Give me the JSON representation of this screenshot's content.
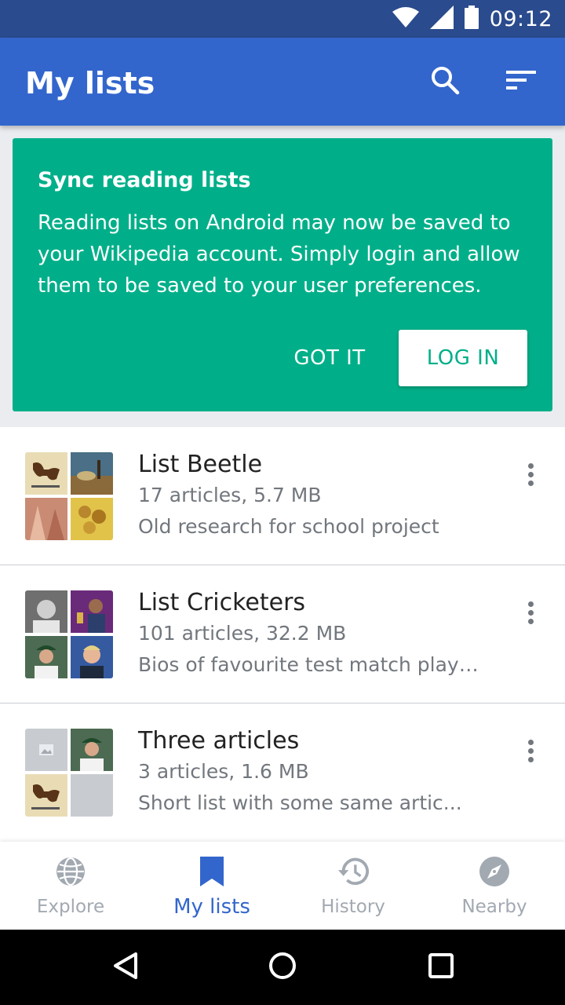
{
  "status_bar": {
    "time": "09:12"
  },
  "app_bar": {
    "title": "My lists"
  },
  "sync_card": {
    "title": "Sync reading lists",
    "body": "Reading lists on Android may now be saved to your Wikipedia account. Simply login and allow them to be saved to your user preferences.",
    "dismiss_label": "GOT IT",
    "login_label": "LOG IN"
  },
  "lists": [
    {
      "title": "List Beetle",
      "stats": "17 articles, 5.7 MB",
      "description": "Old research for school project"
    },
    {
      "title": "List Cricketers",
      "stats": "101 articles, 32.2 MB",
      "description": "Bios of favourite test match play…"
    },
    {
      "title": "Three articles",
      "stats": "3 articles, 1.6 MB",
      "description": "Short list with some same artic..."
    }
  ],
  "bottom_nav": [
    {
      "label": "Explore",
      "icon": "globe-icon",
      "active": false
    },
    {
      "label": "My lists",
      "icon": "bookmark-icon",
      "active": true
    },
    {
      "label": "History",
      "icon": "history-icon",
      "active": false
    },
    {
      "label": "Nearby",
      "icon": "compass-icon",
      "active": false
    }
  ],
  "colors": {
    "app_bar": "#3366cc",
    "status_bar": "#2a4b8d",
    "card": "#00af89",
    "active": "#3366cc",
    "inactive": "#a2a9b1"
  }
}
